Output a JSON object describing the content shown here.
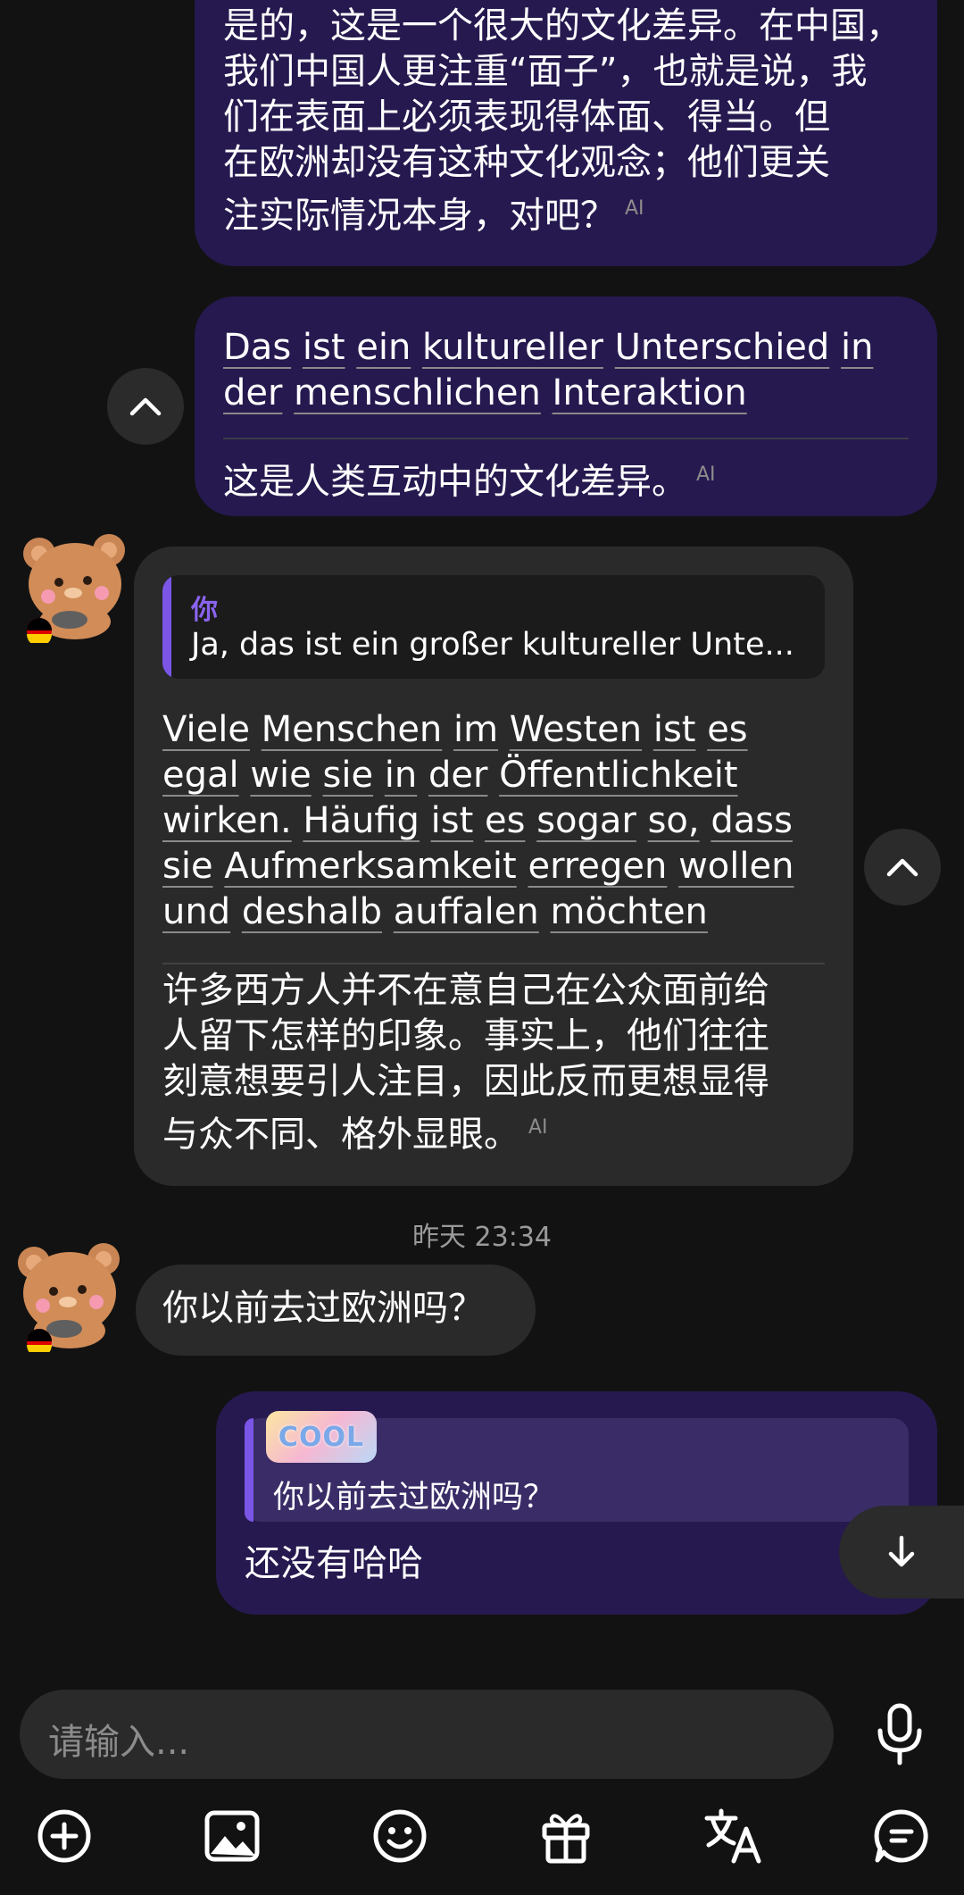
{
  "messages": {
    "m1": {
      "zh_lines": [
        "是的，这是一个很大的文化差异。在中国，",
        "我们中国人更注重“面子”，也就是说，我",
        "们在表面上必须表现得体面、得当。但",
        "在欧洲却没有这种文化观念；他们更关",
        "注实际情况本身，对吧？"
      ],
      "ai_badge": "AI"
    },
    "m2": {
      "de_words_line1": [
        "Das",
        "ist",
        "ein",
        "kultureller",
        "Unterschied",
        "in"
      ],
      "de_words_line2": [
        "der",
        "menschlichen",
        "Interaktion"
      ],
      "zh": "这是人类互动中的文化差异。",
      "ai_badge": "AI"
    },
    "m3": {
      "quote_author": "你",
      "quote_text": "Ja, das ist ein großer kultureller Unte...",
      "de_lines": [
        [
          "Viele",
          "Menschen",
          "im",
          "Westen",
          "ist",
          "es"
        ],
        [
          "egal",
          "wie",
          "sie",
          "in",
          "der",
          "Öffentlichkeit"
        ],
        [
          "wirken.",
          "Häufig",
          "ist",
          "es",
          "sogar",
          "so,",
          "dass"
        ],
        [
          "sie",
          "Aufmerksamkeit",
          "erregen",
          "wollen"
        ],
        [
          "und",
          "deshalb",
          "auffalen",
          "möchten"
        ]
      ],
      "zh_lines": [
        "许多西方人并不在意自己在公众面前给",
        "人留下怎样的印象。事实上，他们往往",
        "刻意想要引人注目，因此反而更想显得",
        "与众不同、格外显眼。"
      ],
      "ai_badge": "AI"
    },
    "timestamp": "昨天 23:34",
    "m4": {
      "text": "你以前去过欧洲吗？"
    },
    "m5": {
      "sticker_text": "COOL",
      "quote_text": "你以前去过欧洲吗？",
      "text": "还没有哈哈"
    }
  },
  "input": {
    "placeholder": "请输入..."
  },
  "toolbar": [
    "add-icon",
    "image-icon",
    "emoji-icon",
    "gift-icon",
    "translate-icon",
    "chat-icon"
  ],
  "colors": {
    "background": "#121212",
    "outgoing_bubble": "#26194f",
    "incoming_bubble": "#2a2a2b",
    "accent": "#7b56e6"
  }
}
